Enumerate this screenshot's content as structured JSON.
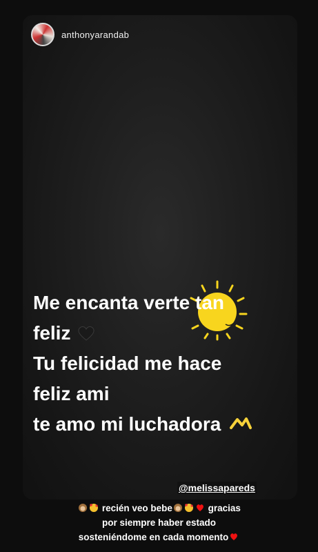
{
  "story": {
    "username": "anthonyarandab",
    "text_lines": [
      "Me encanta verte tan",
      "feliz",
      "Tu felicidad me hace",
      "feliz ami",
      "te amo mi luchadora"
    ],
    "mention": "@melissapareds"
  },
  "caption": {
    "line1_a": "recién veo bebe",
    "line1_b": "gracias",
    "line2": "por siempre haber estado",
    "line3": "sosteniéndome en cada momento"
  },
  "icons": {
    "heart_color": "#1a1a1a",
    "sparkle_color": "#f7d23a",
    "sun_color": "#f8d51e"
  }
}
